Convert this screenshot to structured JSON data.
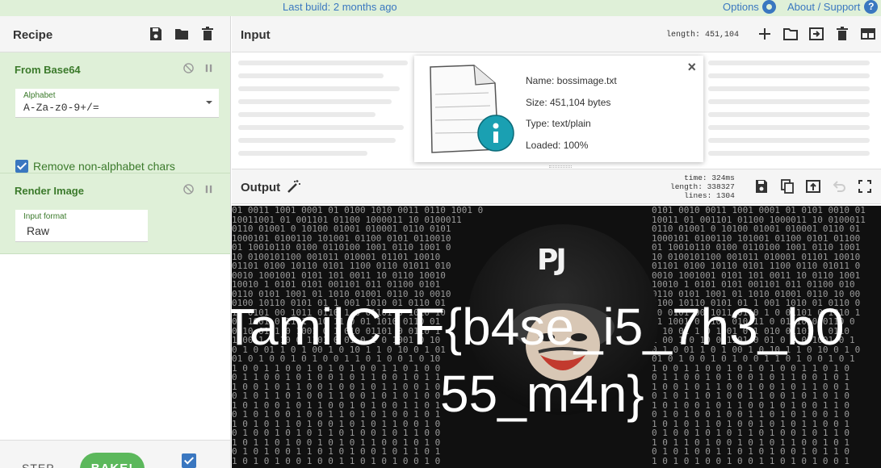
{
  "banner": {
    "last_build": "Last build: 2 months ago",
    "options": "Options",
    "about": "About / Support"
  },
  "recipe": {
    "title": "Recipe",
    "operations": [
      {
        "name": "From Base64",
        "field_label": "Alphabet",
        "field_value": "A-Za-z0-9+/=",
        "checkbox_label": "Remove non-alphabet chars",
        "checkbox_checked": true
      },
      {
        "name": "Render Image",
        "field_label": "Input format",
        "field_value": "Raw"
      }
    ],
    "step_label": "STEP",
    "bake_label": "BAKE!",
    "auto_bake_checked": true
  },
  "input": {
    "title": "Input",
    "length_label": "length: 451,104",
    "file": {
      "name": "Name: bossimage.txt",
      "size": "Size: 451,104 bytes",
      "type": "Type: text/plain",
      "loaded": "Loaded: 100%"
    }
  },
  "output": {
    "title": "Output",
    "time": "time:  324ms",
    "length": "length: 338327",
    "lines": "lines:   1304",
    "image_text_line1": "TamilCTF{b4se_i5_7h3_b0",
    "image_text_line2": "55_m4n}",
    "image_logo": "PJ"
  },
  "colors": {
    "banner_bg": "#dff0d8",
    "accent_blue": "#3a77c0",
    "op_green_text": "#3b7a2b",
    "bake_green": "#5cb85c"
  }
}
